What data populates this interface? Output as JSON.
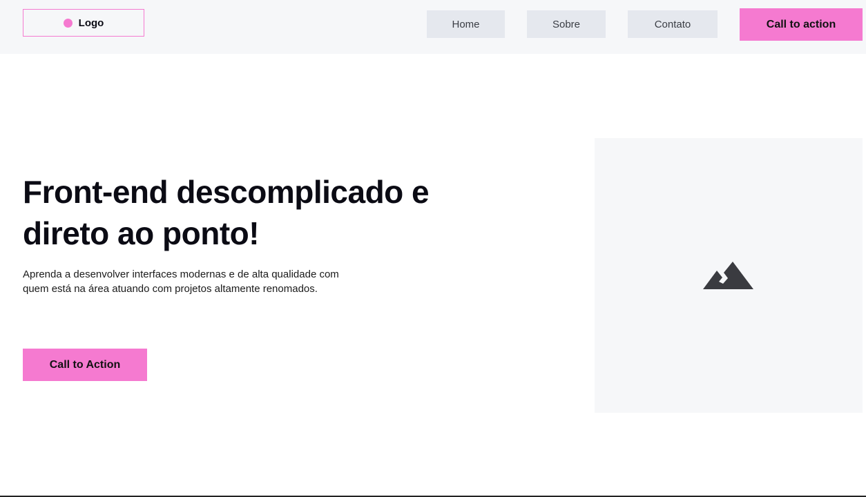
{
  "header": {
    "logo": "Logo",
    "nav": [
      "Home",
      "Sobre",
      "Contato"
    ],
    "cta": "Call to action"
  },
  "hero": {
    "title": "Front-end descomplicado e direto ao ponto!",
    "description": "Aprenda a desenvolver interfaces modernas e de alta qualidade com quem está na área atuando com projetos altamente renomados.",
    "button": "Call to Action",
    "image_icon": "image-placeholder-icon"
  },
  "colors": {
    "accent": "#f57ad0",
    "header_bg": "#f6f7f9",
    "nav_bg": "#e5e8ee"
  }
}
